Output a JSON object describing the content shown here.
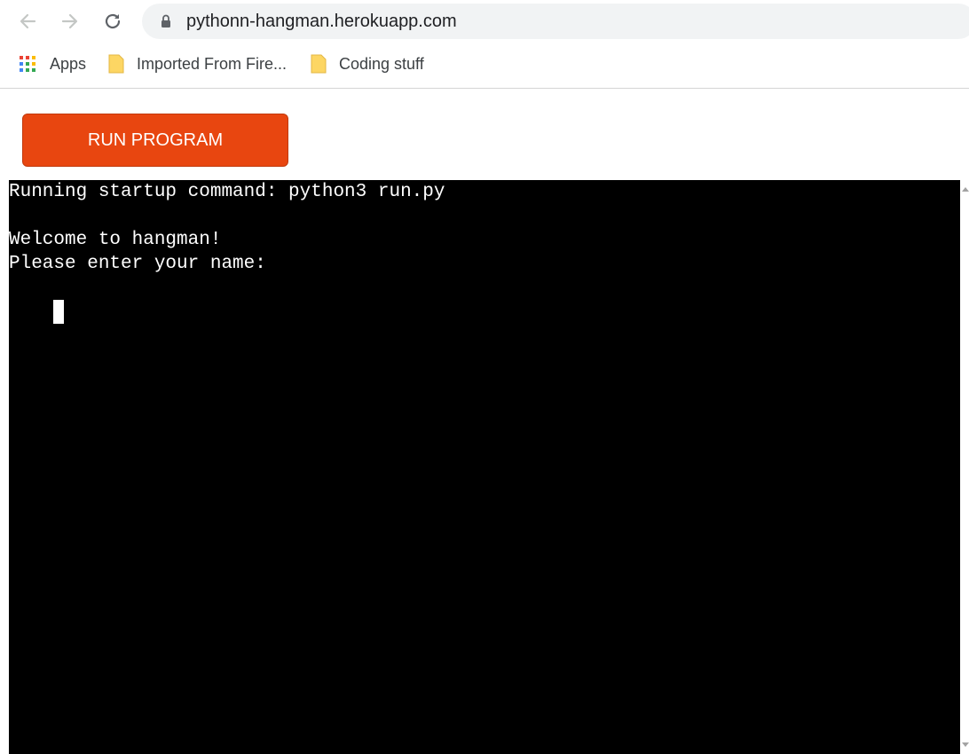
{
  "browser": {
    "url": "pythonn-hangman.herokuapp.com",
    "bookmarks": [
      {
        "label": "Apps",
        "icon": "apps-grid-icon"
      },
      {
        "label": "Imported From Fire...",
        "icon": "folder-icon"
      },
      {
        "label": "Coding stuff",
        "icon": "folder-icon"
      }
    ]
  },
  "page": {
    "run_button_label": "RUN PROGRAM"
  },
  "terminal": {
    "lines": [
      "Running startup command: python3 run.py",
      "",
      "Welcome to hangman!",
      "Please enter your name:"
    ]
  },
  "colors": {
    "accent": "#e84610",
    "terminal_bg": "#000000",
    "terminal_fg": "#ffffff",
    "folder": "#fdd663"
  }
}
